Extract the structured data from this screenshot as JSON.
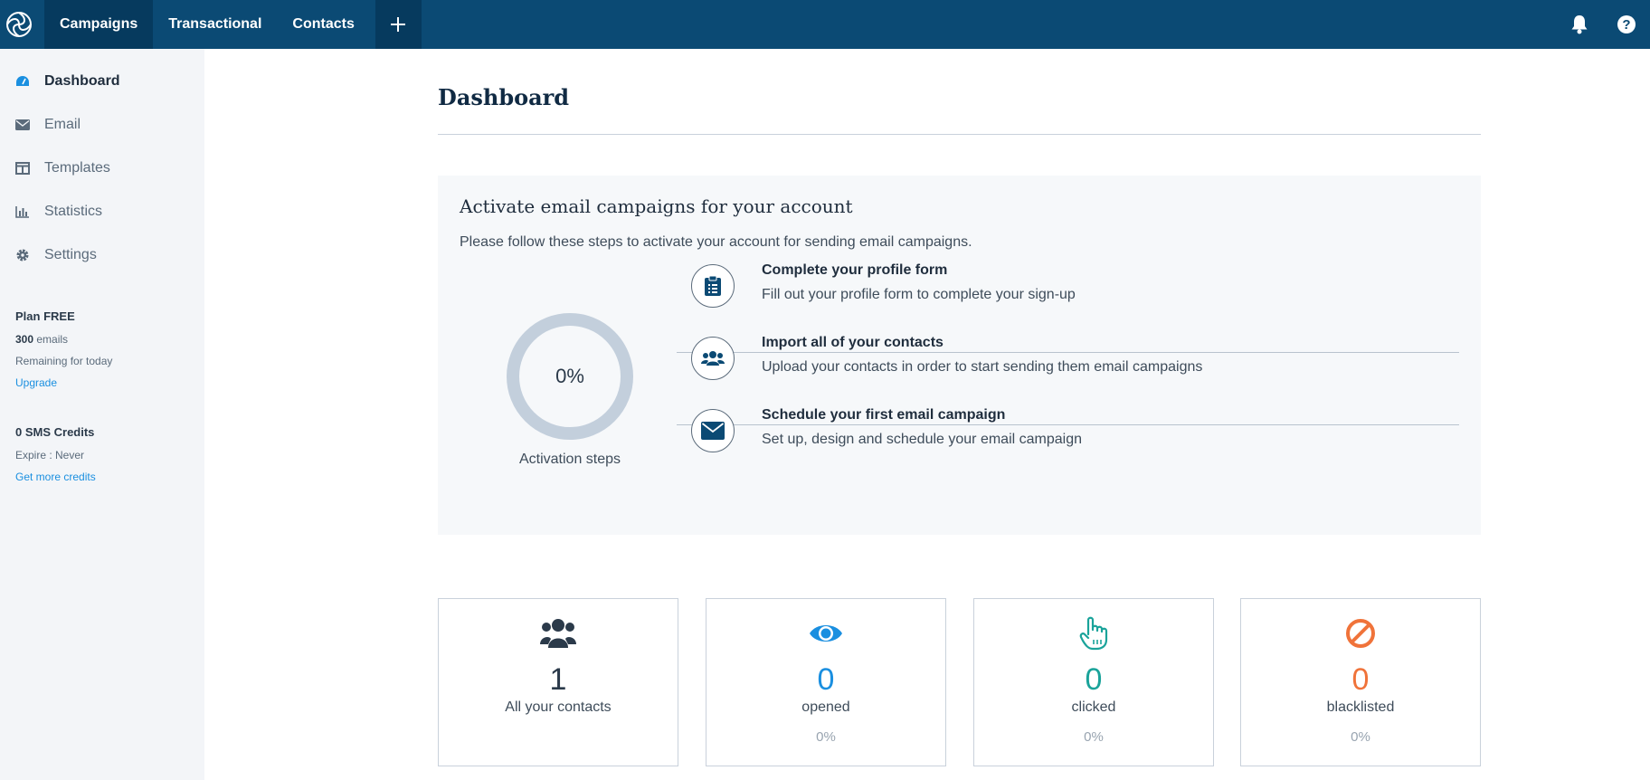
{
  "topbar": {
    "logo_icon": "brand-spiral-logo",
    "tabs": [
      {
        "label": "Campaigns",
        "active": true
      },
      {
        "label": "Transactional",
        "active": false
      },
      {
        "label": "Contacts",
        "active": false
      }
    ],
    "add_icon": "plus-icon",
    "right_icons": [
      "bell-icon",
      "help-icon"
    ],
    "colors": {
      "bar": "#0b4a74",
      "active_tab": "#063a5e"
    }
  },
  "sidebar": {
    "items": [
      {
        "label": "Dashboard",
        "icon": "dashboard-gauge-icon",
        "active": true
      },
      {
        "label": "Email",
        "icon": "envelope-icon",
        "active": false
      },
      {
        "label": "Templates",
        "icon": "template-layout-icon",
        "active": false
      },
      {
        "label": "Statistics",
        "icon": "bar-chart-icon",
        "active": false
      },
      {
        "label": "Settings",
        "icon": "gear-icon",
        "active": false
      }
    ],
    "plan": {
      "title": "Plan FREE",
      "emails_count": "300",
      "emails_unit": " emails",
      "remaining": "Remaining for today",
      "upgrade": "Upgrade"
    },
    "sms": {
      "title": "0 SMS Credits",
      "expire": "Expire : Never",
      "link": "Get more credits"
    }
  },
  "main": {
    "title": "Dashboard",
    "activation": {
      "title": "Activate email campaigns for your account",
      "subtitle": "Please follow these steps to activate your account for sending email campaigns.",
      "progress_label": "0%",
      "progress_value": 0,
      "ring_caption": "Activation steps",
      "steps": [
        {
          "title": "Complete your profile form",
          "description": "Fill out your profile form to complete your sign-up",
          "icon": "clipboard-icon"
        },
        {
          "title": "Import all of your contacts",
          "description": "Upload your contacts in order to start sending them email campaigns",
          "icon": "users-icon"
        },
        {
          "title": "Schedule your first email campaign",
          "description": "Set up, design and schedule your email campaign",
          "icon": "envelope-icon"
        }
      ]
    },
    "stats": [
      {
        "value": "1",
        "label": "All your contacts",
        "percent": "",
        "icon": "users-icon",
        "color": "#2b3a4a"
      },
      {
        "value": "0",
        "label": "opened",
        "percent": "0%",
        "icon": "eye-icon",
        "color": "#1a8fe0"
      },
      {
        "value": "0",
        "label": "clicked",
        "percent": "0%",
        "icon": "pointer-hand-icon",
        "color": "#1aa39a"
      },
      {
        "value": "0",
        "label": "blacklisted",
        "percent": "0%",
        "icon": "ban-icon",
        "color": "#f0733a"
      }
    ]
  }
}
